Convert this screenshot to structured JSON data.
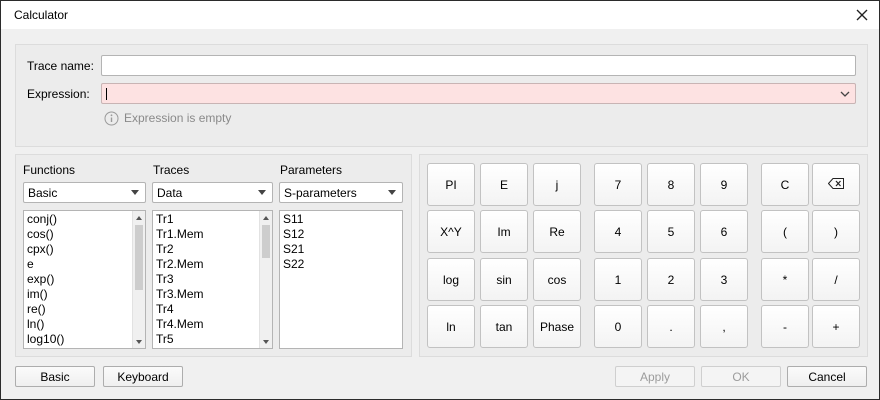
{
  "window": {
    "title": "Calculator"
  },
  "form": {
    "trace_name_label": "Trace name:",
    "trace_name_value": "",
    "expression_label": "Expression:",
    "expression_value": "",
    "hint_text": "Expression is empty"
  },
  "functions": {
    "header": "Functions",
    "selected": "Basic",
    "items": [
      "conj()",
      "cos()",
      "cpx()",
      "e",
      "exp()",
      "im()",
      "re()",
      "ln()",
      "log10()"
    ]
  },
  "traces": {
    "header": "Traces",
    "selected": "Data",
    "items": [
      "Tr1",
      "Tr1.Mem",
      "Tr2",
      "Tr2.Mem",
      "Tr3",
      "Tr3.Mem",
      "Tr4",
      "Tr4.Mem",
      "Tr5"
    ]
  },
  "parameters": {
    "header": "Parameters",
    "selected": "S-parameters",
    "items": [
      "S11",
      "S12",
      "S21",
      "S22"
    ]
  },
  "keypad": {
    "rows": [
      [
        "PI",
        "E",
        "j",
        "7",
        "8",
        "9",
        "C",
        "⌫"
      ],
      [
        "X^Y",
        "Im",
        "Re",
        "4",
        "5",
        "6",
        "(",
        ")"
      ],
      [
        "log",
        "sin",
        "cos",
        "1",
        "2",
        "3",
        "*",
        "/"
      ],
      [
        "ln",
        "tan",
        "Phase",
        "0",
        ".",
        ",",
        "-",
        "+"
      ]
    ]
  },
  "footer": {
    "basic_label": "Basic",
    "keyboard_label": "Keyboard",
    "apply_label": "Apply",
    "ok_label": "OK",
    "cancel_label": "Cancel"
  },
  "icons": {
    "close": "close-icon",
    "info": "info-icon",
    "backspace": "backspace-icon",
    "dropdown": "chevron-down-icon"
  }
}
